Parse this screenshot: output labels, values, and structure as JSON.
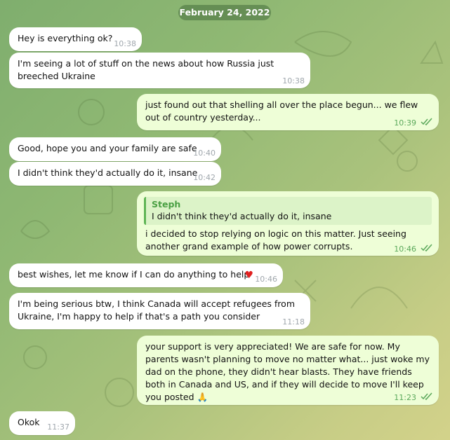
{
  "date": "February 24, 2022",
  "messages": [
    {
      "text": "Hey is everything ok?",
      "time": "10:38"
    },
    {
      "text": "I'm seeing a lot of stuff on the news about how Russia just breeched Ukraine",
      "time": "10:38"
    },
    {
      "text": "just found out that shelling all over the place begun... we flew out of country yesterday...",
      "time": "10:39"
    },
    {
      "text": "Good, hope you and your family are safe",
      "time": "10:40"
    },
    {
      "text": "I didn't think they'd actually do it, insane",
      "time": "10:42"
    },
    {
      "reply_name": "Steph",
      "reply_text": "I didn't think they'd actually do it, insane",
      "text": "i decided to stop relying on logic on this matter. Just seeing another grand example of how power corrupts.",
      "time": "10:46"
    },
    {
      "text": "best wishes, let me know if I can do anything to help",
      "time": "10:46",
      "reaction": "♥"
    },
    {
      "text": "I'm being serious btw, I think Canada will accept refugees from Ukraine, I'm happy to help if that's a path you consider",
      "time": "11:18"
    },
    {
      "text": "your support is very appreciated! We are safe for now. My parents wasn't planning to move no matter what... just woke my dad on the phone, they didn't hear blasts. They have friends both in Canada and US, and if they will decide to move I'll keep you posted 🙏",
      "time": "11:23"
    },
    {
      "text": "Okok",
      "time": "11:37"
    }
  ],
  "icons": {
    "read_receipt": "double-check-icon",
    "reaction": "heart-icon"
  },
  "colors": {
    "incoming": "#ffffff",
    "outgoing": "#eefed7",
    "accent": "#5aa85a"
  }
}
